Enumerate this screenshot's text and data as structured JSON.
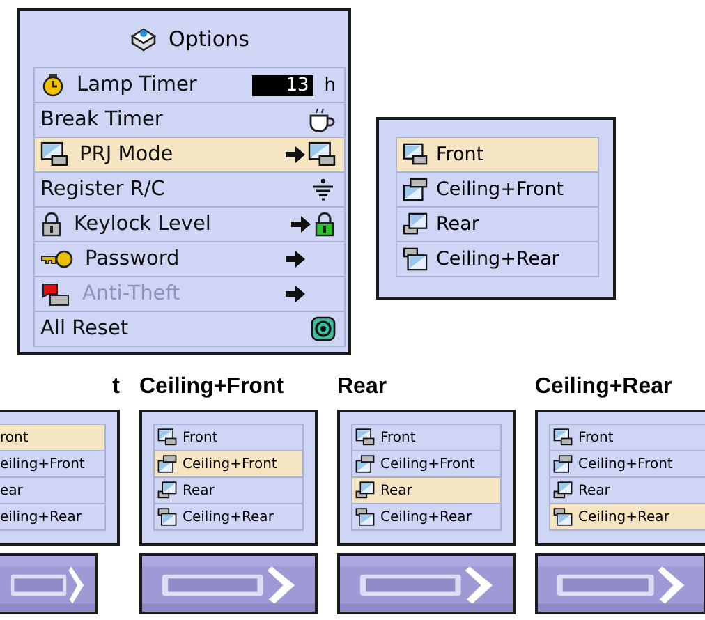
{
  "menu": {
    "title": "Options",
    "rows": [
      {
        "label": "Lamp Timer",
        "value": "13",
        "unit": "h",
        "selected": false,
        "disabled": false
      },
      {
        "label": "Break Timer",
        "selected": false,
        "disabled": false
      },
      {
        "label": "PRJ Mode",
        "selected": true,
        "disabled": false
      },
      {
        "label": "Register R/C",
        "selected": false,
        "disabled": false
      },
      {
        "label": "Keylock Level",
        "selected": false,
        "disabled": false
      },
      {
        "label": "Password",
        "selected": false,
        "disabled": false
      },
      {
        "label": "Anti-Theft",
        "selected": false,
        "disabled": true
      },
      {
        "label": "All Reset",
        "selected": false,
        "disabled": false
      }
    ]
  },
  "submenu": {
    "items": [
      {
        "label": "Front",
        "selected": true
      },
      {
        "label": "Ceiling+Front",
        "selected": false
      },
      {
        "label": "Rear",
        "selected": false
      },
      {
        "label": "Ceiling+Rear",
        "selected": false
      }
    ]
  },
  "examples": [
    {
      "heading": "t",
      "items": [
        {
          "label": "ront",
          "selected": true
        },
        {
          "label": "eiling+Front",
          "selected": false
        },
        {
          "label": "ear",
          "selected": false
        },
        {
          "label": "eiling+Rear",
          "selected": false
        }
      ]
    },
    {
      "heading": "Ceiling+Front",
      "items": [
        {
          "label": "Front",
          "selected": false
        },
        {
          "label": "Ceiling+Front",
          "selected": true
        },
        {
          "label": "Rear",
          "selected": false
        },
        {
          "label": "Ceiling+Rear",
          "selected": false
        }
      ]
    },
    {
      "heading": "Rear",
      "items": [
        {
          "label": "Front",
          "selected": false
        },
        {
          "label": "Ceiling+Front",
          "selected": false
        },
        {
          "label": "Rear",
          "selected": true
        },
        {
          "label": "Ceiling+Rear",
          "selected": false
        }
      ]
    },
    {
      "heading": "Ceiling+Rear",
      "items": [
        {
          "label": "Front",
          "selected": false
        },
        {
          "label": "Ceiling+Front",
          "selected": false
        },
        {
          "label": "Rear",
          "selected": false
        },
        {
          "label": "Ceiling+Rear",
          "selected": true
        }
      ]
    }
  ]
}
